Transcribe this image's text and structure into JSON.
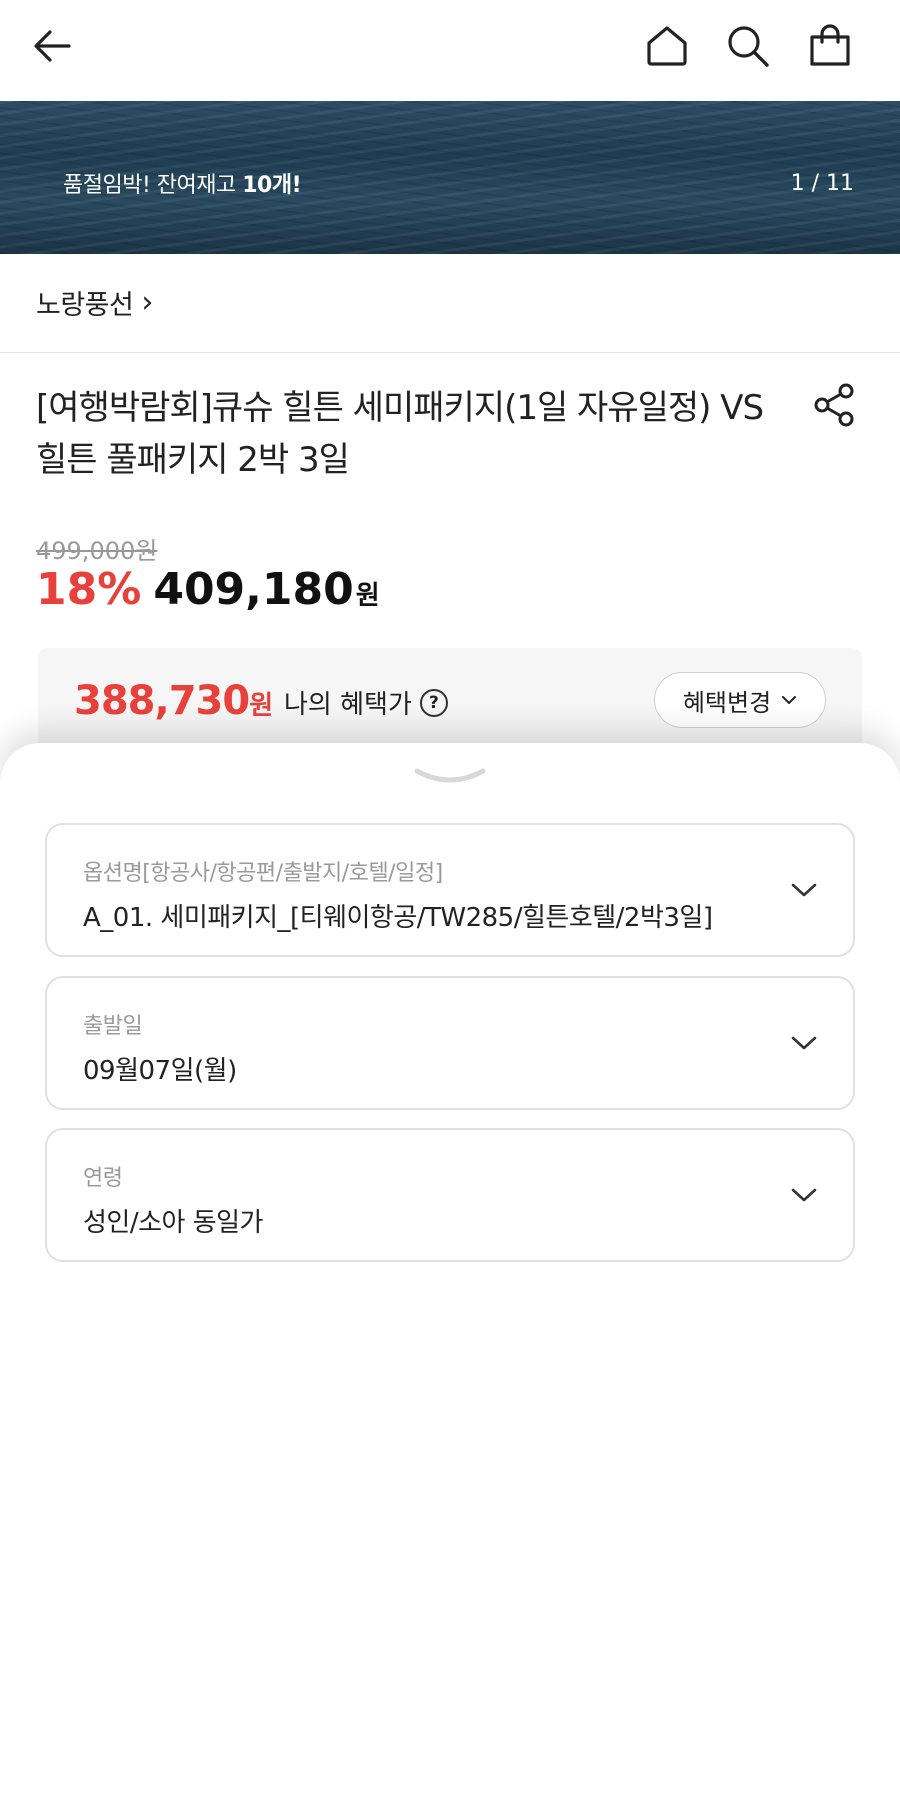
{
  "header": {
    "back_icon": "arrow-left-icon",
    "home_icon": "home-icon",
    "search_icon": "search-icon",
    "cart_icon": "shopping-bag-icon"
  },
  "banner": {
    "stock_prefix": "품절임박! 잔여재고 ",
    "stock_count": "10개!",
    "counter": "1 / 11"
  },
  "seller": {
    "name": "노랑풍선",
    "chevron": "›"
  },
  "product": {
    "title": "[여행박람회]큐슈 힐튼 세미패키지(1일 자유일정) VS 힐튼 풀패키지 2박 3일",
    "original_price": "499,000원",
    "discount_rate": "18%",
    "price": "409,180",
    "price_unit": "원"
  },
  "benefit": {
    "price": "388,730",
    "price_unit": "원",
    "label": "나의 혜택가",
    "help_glyph": "?",
    "change_button": "혜택변경"
  },
  "options": [
    {
      "label": "옵션명[항공사/항공편/출발지/호텔/일정]",
      "value": "A_01. 세미패키지_[티웨이항공/TW285/힐튼호텔/2박3일]"
    },
    {
      "label": "출발일",
      "value": "09월07일(월)"
    },
    {
      "label": "연령",
      "value": "성인/소아 동일가"
    }
  ],
  "colors": {
    "accent_red": "#e8413b",
    "text": "#222222",
    "muted": "#9a9a9a"
  }
}
